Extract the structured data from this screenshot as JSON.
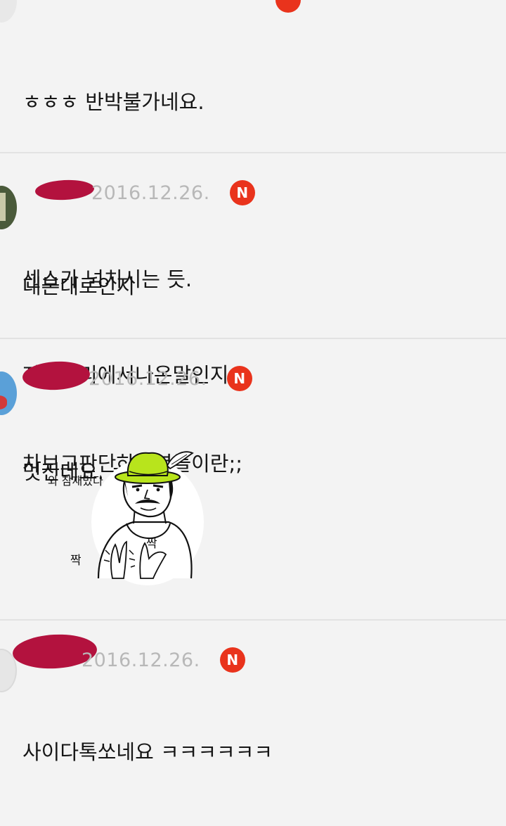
{
  "comments": [
    {
      "author": "",
      "date": "",
      "badge": "",
      "lines": [
        "ㅎㅎㅎ 반박불가네요.",
        "",
        "센스가 넘치시는 듯."
      ]
    },
    {
      "author": "",
      "date": "2016.12.26.",
      "badge": "N",
      "lines": [
        "대본대로인지",
        "자기머리에서나온말인지",
        "차보고판단하는년들이란;;"
      ]
    },
    {
      "author": "",
      "date": "2016.12.26.",
      "badge": "N",
      "lines": [
        "멋진데요. ㅎ"
      ],
      "sticker": {
        "speech": "와 참재밌다",
        "clap_left": "짝",
        "clap_right": "짝"
      }
    },
    {
      "author": "",
      "date": "2016.12.26.",
      "badge": "N",
      "lines": [
        "사이다톡쏘네요 ㅋㅋㅋㅋㅋㅋ"
      ]
    }
  ],
  "colors": {
    "background": "#f3f3f3",
    "badge": "#e9331c",
    "date": "#b8b8b8",
    "redaction": "#b3123e",
    "hat": "#b8e41c"
  }
}
